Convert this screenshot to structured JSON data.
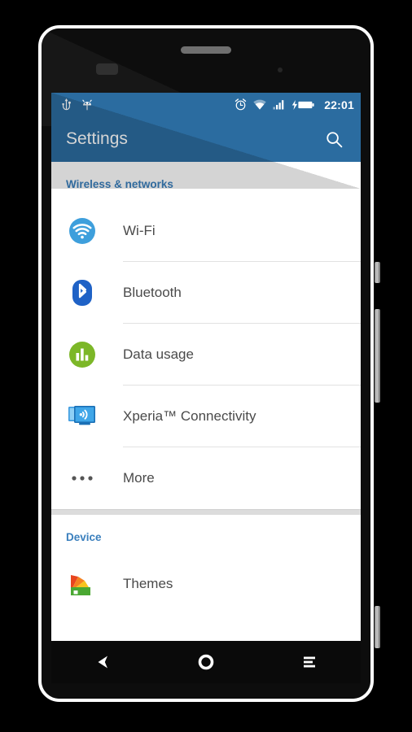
{
  "device": {
    "frame_color": "#ffffff",
    "bezel_color": "#0d0d0d",
    "buttons": [
      {
        "name": "power-button",
        "label": "Power"
      },
      {
        "name": "volume-rocker",
        "label": "Volume"
      },
      {
        "name": "camera-key",
        "label": "Camera"
      }
    ]
  },
  "status_bar": {
    "background": "#2b6ca0",
    "time": "22:01",
    "left_icons": [
      {
        "name": "usb-icon",
        "label": "USB connected"
      },
      {
        "name": "developer-mode-icon",
        "label": "Developer options"
      }
    ],
    "right_icons": [
      {
        "name": "alarm-clock-icon",
        "label": "Alarm set"
      },
      {
        "name": "wifi-signal-icon",
        "label": "Wi-Fi connected"
      },
      {
        "name": "cellular-signal-icon",
        "label": "Mobile signal"
      },
      {
        "name": "battery-charging-icon",
        "label": "Battery charging"
      }
    ]
  },
  "action_bar": {
    "title": "Settings",
    "background": "#2b6ca0",
    "search_label": "Search"
  },
  "settings": {
    "sections": [
      {
        "header": "Wireless & networks",
        "header_color": "#3a7fbd",
        "items": [
          {
            "label": "Wi-Fi",
            "icon": "wifi-icon",
            "icon_color": "#3e9fdc"
          },
          {
            "label": "Bluetooth",
            "icon": "bluetooth-icon",
            "icon_color": "#1f62c6"
          },
          {
            "label": "Data usage",
            "icon": "data-usage-icon",
            "icon_color": "#7cb728"
          },
          {
            "label": "Xperia™ Connectivity",
            "icon": "cast-icon",
            "icon_color": "#3b9ae0"
          },
          {
            "label": "More",
            "icon": "more-icon",
            "icon_color": "#5a5a5a"
          }
        ]
      },
      {
        "header": "Device",
        "header_color": "#3a7fbd",
        "items": [
          {
            "label": "Themes",
            "icon": "themes-icon",
            "icon_color": "#e8451f"
          }
        ]
      }
    ]
  },
  "nav_bar": {
    "background": "#0a0a0a",
    "keys": [
      {
        "name": "back-key",
        "label": "Back"
      },
      {
        "name": "home-key",
        "label": "Home"
      },
      {
        "name": "recents-key",
        "label": "Recent apps"
      }
    ]
  }
}
